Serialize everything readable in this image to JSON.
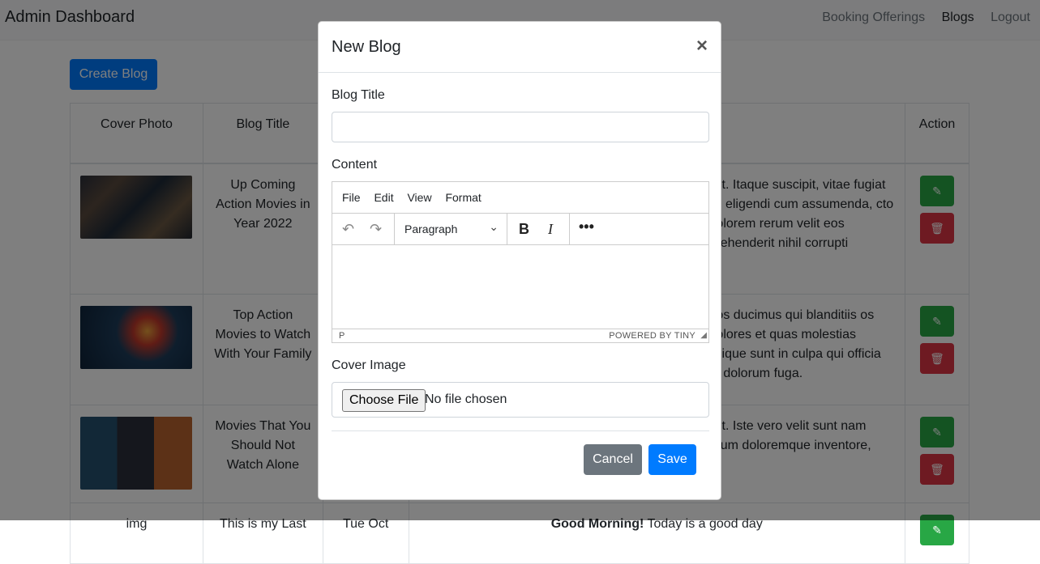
{
  "navbar": {
    "brand": "Admin Dashboard",
    "links": [
      "Booking Offerings",
      "Blogs",
      "Logout"
    ]
  },
  "page": {
    "create_button": "Create Blog",
    "columns": [
      "Cover Photo",
      "Blog Title",
      "",
      "",
      "Action"
    ],
    "rows": [
      {
        "title": "Up Coming Action Movies in Year 2022",
        "date": "",
        "content": "elit. Itaque suscipit, vitae fugiat tis eligendi cum assumenda, cto dolorem rerum velit eos prehenderit nihil corrupti"
      },
      {
        "title": "Top Action Movies to Watch With Your Family",
        "date": "",
        "content": "nos ducimus qui blanditiis os dolores et quas molestias nilique sunt in culpa qui officia et dolorum fuga."
      },
      {
        "title": "Movies That You Should Not Watch Alone",
        "date": "",
        "content": "elit. Iste vero velit sunt nam orum doloremque inventore,"
      },
      {
        "title": "This is my Last",
        "date": "Tue Oct",
        "content_bold": "Good Morning!",
        "content": " Today is a good day",
        "img_alt": "img"
      }
    ]
  },
  "modal": {
    "title": "New Blog",
    "close": "×",
    "blog_title_label": "Blog Title",
    "blog_title_value": "",
    "content_label": "Content",
    "editor": {
      "menus": [
        "File",
        "Edit",
        "View",
        "Format"
      ],
      "block_format": "Paragraph",
      "status_path": "P",
      "branding": "POWERED BY TINY"
    },
    "cover_label": "Cover Image",
    "choose_file": "Choose File",
    "no_file": "No file chosen",
    "cancel": "Cancel",
    "save": "Save"
  },
  "colors": {
    "primary": "#007bff",
    "success": "#28a745",
    "danger": "#dc3545",
    "secondary": "#6c757d"
  }
}
